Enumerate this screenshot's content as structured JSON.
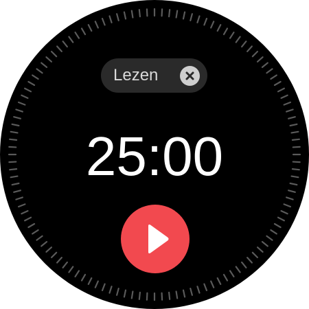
{
  "label": {
    "text": "Lezen",
    "clear_icon": "close-circle-icon"
  },
  "timer": {
    "display": "25:00"
  },
  "controls": {
    "play_icon": "play-icon",
    "play_color": "#f2494f"
  },
  "colors": {
    "background": "#000000",
    "ticks": "#5a5a5a",
    "chip": "#2a2a2a",
    "timer_text": "#ffffff"
  }
}
